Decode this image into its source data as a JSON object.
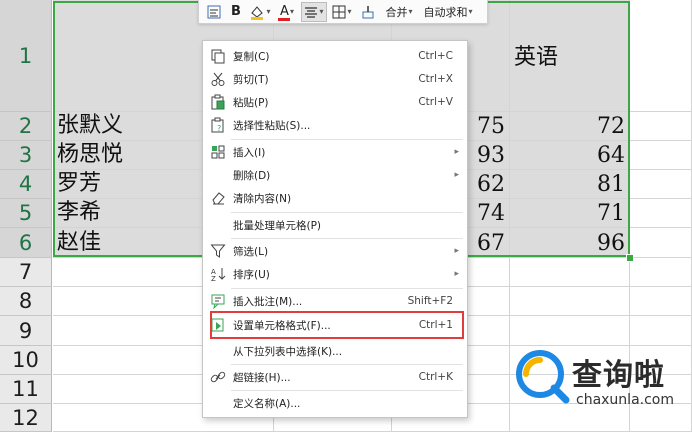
{
  "sheet": {
    "row_headers": [
      "1",
      "2",
      "3",
      "4",
      "5",
      "6",
      "7",
      "8",
      "9",
      "10",
      "11",
      "12"
    ],
    "header_row": {
      "e": "英语"
    },
    "rows": [
      {
        "name": "张默义",
        "d": "75",
        "e": "72"
      },
      {
        "name": "杨思悦",
        "d": "93",
        "e": "64"
      },
      {
        "name": "罗芳",
        "d": "62",
        "e": "81"
      },
      {
        "name": "李希",
        "d": "74",
        "e": "71"
      },
      {
        "name": "赵佳",
        "d": "67",
        "e": "96"
      }
    ]
  },
  "toolbar": {
    "bold_label": "B",
    "font_color_label": "A",
    "merge_label": "合并",
    "autosum_label": "自动求和"
  },
  "menu": {
    "items": [
      {
        "label": "复制(C)",
        "shortcut": "Ctrl+C",
        "icon": "copy-icon"
      },
      {
        "label": "剪切(T)",
        "shortcut": "Ctrl+X",
        "icon": "cut-icon"
      },
      {
        "label": "粘贴(P)",
        "shortcut": "Ctrl+V",
        "icon": "paste-icon"
      },
      {
        "label": "选择性粘贴(S)...",
        "shortcut": "",
        "icon": "paste-special-icon"
      },
      {
        "label": "插入(I)",
        "shortcut": "",
        "icon": "insert-icon",
        "submenu": true
      },
      {
        "label": "删除(D)",
        "shortcut": "",
        "icon": "",
        "submenu": true
      },
      {
        "label": "清除内容(N)",
        "shortcut": "",
        "icon": "eraser-icon"
      },
      {
        "label": "批量处理单元格(P)",
        "shortcut": "",
        "icon": ""
      },
      {
        "label": "筛选(L)",
        "shortcut": "",
        "icon": "filter-icon",
        "submenu": true
      },
      {
        "label": "排序(U)",
        "shortcut": "",
        "icon": "sort-icon",
        "submenu": true
      },
      {
        "label": "插入批注(M)...",
        "shortcut": "Shift+F2",
        "icon": "comment-icon"
      },
      {
        "label": "设置单元格格式(F)...",
        "shortcut": "Ctrl+1",
        "icon": "format-cells-icon"
      },
      {
        "label": "从下拉列表中选择(K)...",
        "shortcut": "",
        "icon": ""
      },
      {
        "label": "超链接(H)...",
        "shortcut": "Ctrl+K",
        "icon": "link-icon"
      },
      {
        "label": "定义名称(A)...",
        "shortcut": "",
        "icon": ""
      }
    ]
  },
  "watermark": {
    "brand": "查询啦",
    "url": "chaxunla.com"
  },
  "colors": {
    "selection": "#3ca843",
    "highlight": "#e23d3d",
    "row_selected_text": "#217346"
  }
}
